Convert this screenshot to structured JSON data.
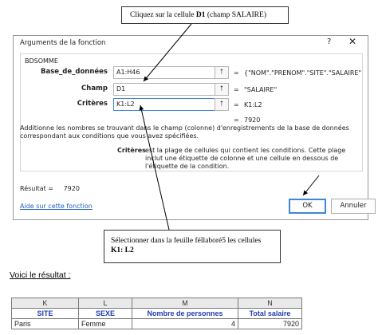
{
  "callout_top": {
    "text_pre": "Cliquez sur la cellule ",
    "text_bold": "D1",
    "text_post": " (champ SALAIRE)"
  },
  "callout_bottom": {
    "line1": "Sélectionner dans la feuille féllaboré5 les cellules",
    "line2": "K1: L2"
  },
  "dialog": {
    "title": "Arguments de la fonction",
    "help": "?",
    "close": "✕",
    "function_name": "BDSOMME",
    "args": [
      {
        "label": "Base_de_données",
        "value": "A1:H46",
        "eq": "=",
        "result": "{\"NOM\".\"PRENOM\".\"SITE\".\"SALAIRE\""
      },
      {
        "label": "Champ",
        "value": "D1",
        "eq": "=",
        "result": "\"SALAIRE\""
      },
      {
        "label": "Critères",
        "value": "K1:L2",
        "eq": "=",
        "result": "K1:L2"
      }
    ],
    "result_eq": "=",
    "result_preview": "7920",
    "description": "Additionne les nombres se trouvant dans le champ (colonne) d'enregistrements de la base de données correspondant aux conditions que vous avez spécifiées.",
    "arg_desc_label": "Critères",
    "arg_desc": "est la plage de cellules qui contient les conditions. Cette plage inclut une étiquette de colonne et une cellule en dessous de l'étiquette de la condition.",
    "result_label": "Résultat =",
    "result_value": "7920",
    "help_link": "Aide sur cette fonction",
    "ok": "OK",
    "cancel": "Annuler"
  },
  "voici": "Voici le résultat :",
  "sheet": {
    "columns": [
      "K",
      "L",
      "M",
      "N"
    ],
    "headers": [
      "SITE",
      "SEXE",
      "Nombre de personnes",
      "Total salaire"
    ],
    "row": [
      "Paris",
      "Femme",
      "4",
      "7920"
    ]
  }
}
